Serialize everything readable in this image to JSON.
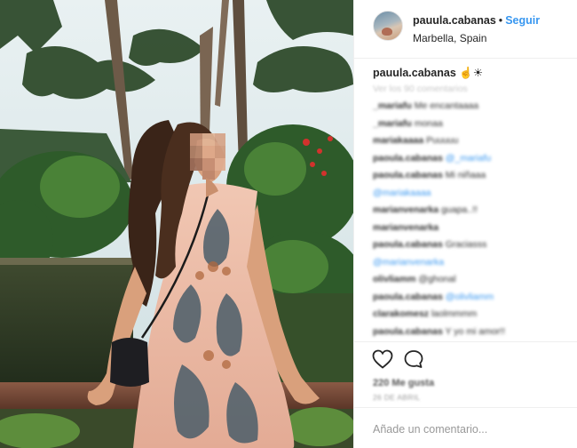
{
  "post": {
    "username": "pauula.cabanas",
    "separator": "•",
    "follow_label": "Seguir",
    "location": "Marbella, Spain",
    "caption": {
      "username": "pauula.cabanas",
      "text": "☝☀"
    },
    "view_all_comments": "Ver los 90 comentarios",
    "comments": [
      {
        "user": "_mariafu",
        "text": "Me encantaaaa",
        "mention": ""
      },
      {
        "user": "_mariafu",
        "text": "monaa",
        "mention": ""
      },
      {
        "user": "mariakaaaa",
        "text": "Puuuuu",
        "mention": ""
      },
      {
        "user": "paoula.cabanas",
        "text": "",
        "mention": "@_mariafu"
      },
      {
        "user": "paoula.cabanas",
        "text": "Mi niñaaa",
        "mention": ""
      },
      {
        "user": "",
        "text": "",
        "mention": "@mariakaaaa"
      },
      {
        "user": "marianvenarka",
        "text": "guapa..!!",
        "mention": ""
      },
      {
        "user": "marianvenarka",
        "text": "",
        "mention": ""
      },
      {
        "user": "paoula.cabanas",
        "text": "Graciasss",
        "mention": ""
      },
      {
        "user": "",
        "text": "",
        "mention": "@marianvenarka"
      },
      {
        "user": "olivliamm",
        "text": "@ghonal",
        "mention": ""
      },
      {
        "user": "paoula.cabanas",
        "text": "",
        "mention": "@olivliamm"
      },
      {
        "user": "clarakomesz",
        "text": "laolmmmm",
        "mention": ""
      },
      {
        "user": "paoula.cabanas",
        "text": "Y yo mi amor!!",
        "mention": ""
      }
    ],
    "likes": "220 Me gusta",
    "timestamp": "26 DE ABRIL",
    "comment_placeholder": "Añade un comentario..."
  },
  "icons": {
    "like": "heart-icon",
    "comment": "comment-bubble-icon"
  },
  "colors": {
    "link_blue": "#3897f0",
    "text": "#262626",
    "border": "#efefef"
  }
}
